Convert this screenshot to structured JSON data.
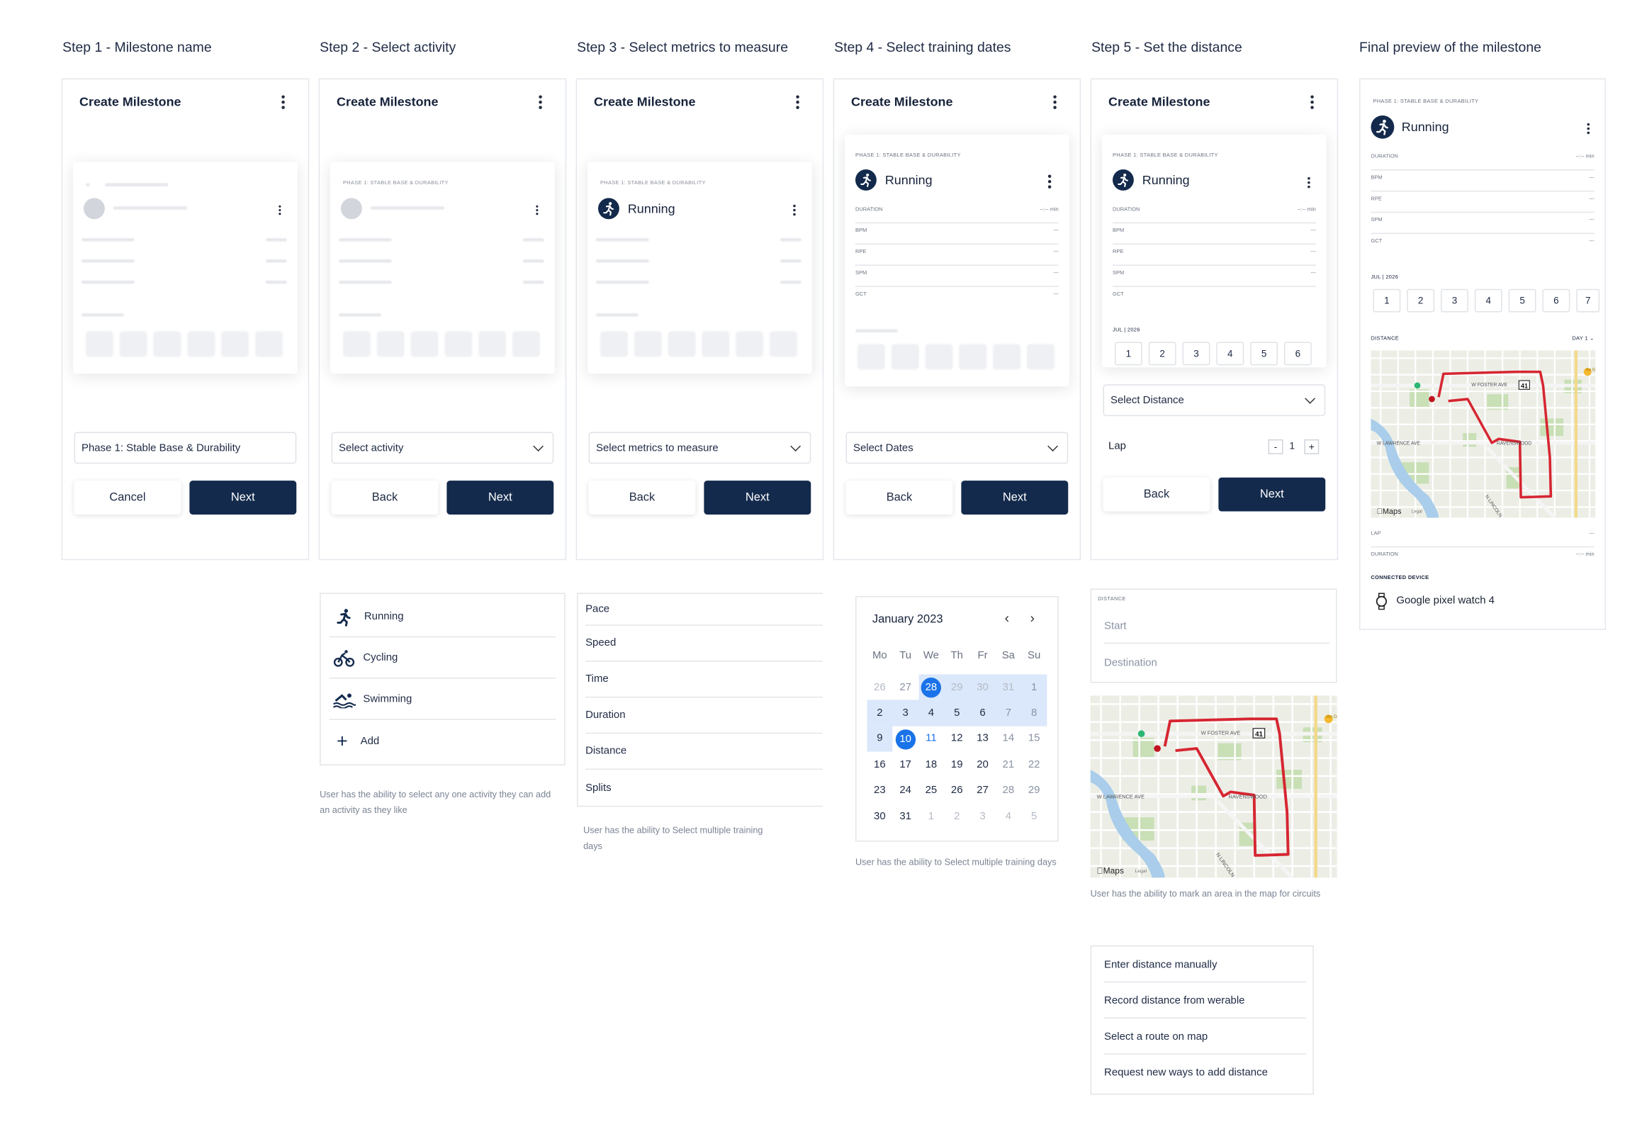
{
  "steps": [
    {
      "title": "Step 1 - Milestone name",
      "header": "Create Milestone",
      "field": "Phase 1: Stable Base & Durability",
      "back": "Cancel",
      "next": "Next",
      "ghost_phase": ""
    },
    {
      "title": "Step 2 - Select activity",
      "header": "Create Milestone",
      "field": "Select activity",
      "back": "Back",
      "next": "Next",
      "ghost_phase": "PHASE 1: STABLE BASE & DURABILITY"
    },
    {
      "title": "Step 3 - Select metrics to measure",
      "header": "Create Milestone",
      "field": "Select metrics to measure",
      "back": "Back",
      "next": "Next",
      "ghost_phase": "PHASE 1: STABLE BASE & DURABILITY",
      "activity": "Running"
    },
    {
      "title": "Step 4 - Select training dates",
      "header": "Create Milestone",
      "field": "Select Dates",
      "back": "Back",
      "next": "Next",
      "ghost_phase": "PHASE 1: STABLE BASE & DURABILITY",
      "activity": "Running"
    },
    {
      "title": "Step 5 - Set the distance",
      "header": "Create Milestone",
      "field": "Select Distance",
      "lap_label": "Lap",
      "lap_value": "1",
      "back": "Back",
      "next": "Next",
      "ghost_phase": "PHASE 1: STABLE BASE & DURABILITY",
      "activity": "Running"
    }
  ],
  "metrics_card": {
    "duration": "DURATION",
    "duration_val": "--:-- min",
    "bpm": "BPM",
    "rpe": "RPE",
    "spm": "SPM",
    "gct": "GCT",
    "dash": "---",
    "month": "JUL | 2026",
    "days": [
      "1",
      "2",
      "3",
      "4",
      "5",
      "6"
    ]
  },
  "preview": {
    "title": "Final preview of the milestone",
    "phase": "PHASE 1: STABLE BASE & DURABILITY",
    "activity": "Running",
    "duration": "DURATION",
    "duration_val": "--:-- min",
    "bpm": "BPM",
    "rpe": "RPE",
    "spm": "SPM",
    "gct": "GCT",
    "dash": "---",
    "month": "JUL | 2026",
    "days": [
      "1",
      "2",
      "3",
      "4",
      "5",
      "6",
      "7"
    ],
    "distance_label": "DISTANCE",
    "day_selector": "DAY 1",
    "lap": "LAP",
    "lap_val": "---",
    "duration2": "DURATION",
    "duration2_val": "--:-- min",
    "device_label": "CONNECTED DEVICE",
    "device": "Google pixel watch 4"
  },
  "activities": {
    "items": [
      "Running",
      "Cycling",
      "Swimming",
      "Add"
    ],
    "caption": "User has the ability to select any one activity they can add an activity as they like"
  },
  "metrics": {
    "items": [
      "Pace",
      "Speed",
      "Time",
      "Duration",
      "Distance",
      "Splits"
    ],
    "caption": "User has the ability to Select multiple training days"
  },
  "calendar": {
    "month": "January 2023",
    "weekdays": [
      "Mo",
      "Tu",
      "We",
      "Th",
      "Fr",
      "Sa",
      "Su"
    ],
    "rows": [
      [
        "26",
        "27",
        "28",
        "29",
        "30",
        "31",
        "1"
      ],
      [
        "2",
        "3",
        "4",
        "5",
        "6",
        "7",
        "8"
      ],
      [
        "9",
        "10",
        "11",
        "12",
        "13",
        "14",
        "15"
      ],
      [
        "16",
        "17",
        "18",
        "19",
        "20",
        "21",
        "22"
      ],
      [
        "23",
        "24",
        "25",
        "26",
        "27",
        "28",
        "29"
      ],
      [
        "30",
        "31",
        "1",
        "2",
        "3",
        "4",
        "5"
      ]
    ],
    "caption": "User has the ability to Select multiple training days"
  },
  "distance_panel": {
    "label": "DISTANCE",
    "start": "Start",
    "destination": "Destination",
    "caption": "User has the ability to mark an area in the map for circuits"
  },
  "map": {
    "street1": "W FOSTER AVE",
    "street2": "W LAWRENCE AVE",
    "area": "RAVENSWOOD",
    "street3": "N LINCOLN",
    "route": "41",
    "brand": "Maps",
    "legal": "Legal",
    "poi": "An Ga"
  },
  "distance_options": [
    "Enter distance manually",
    "Record distance from werable",
    "Select a route on map",
    "Request new ways to add distance"
  ],
  "colors": {
    "primary": "#132a4c",
    "accent": "#1a73e8",
    "route": "#d62631",
    "selected_range": "#dbe8fb"
  }
}
